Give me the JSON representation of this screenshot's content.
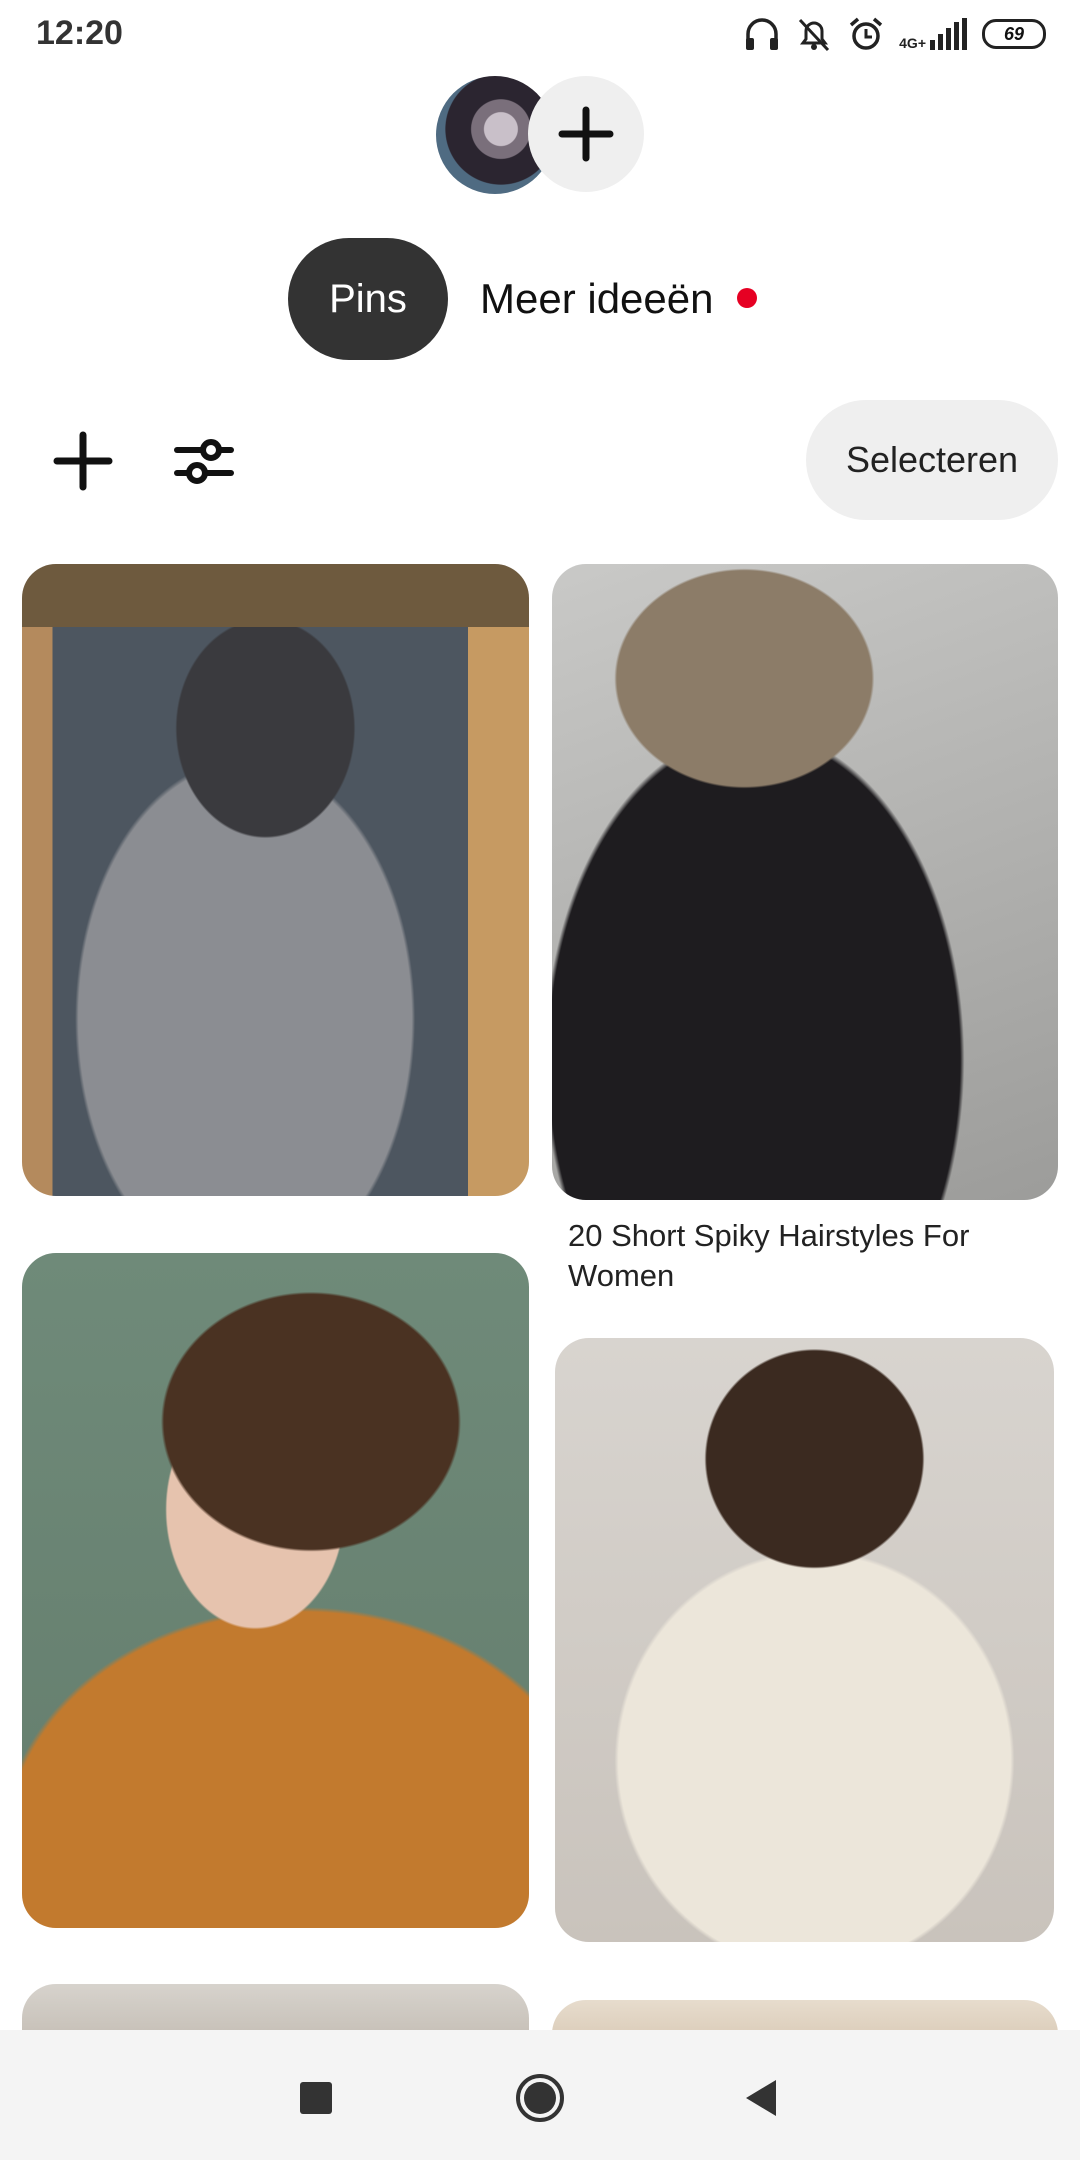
{
  "status_bar": {
    "time": "12:20",
    "network_label": "4G+",
    "battery": "69",
    "icons": [
      "headphones-icon",
      "alarm-muted-icon",
      "alarm-clock-icon",
      "signal-icon",
      "battery-icon"
    ]
  },
  "header": {
    "avatar_icon": "profile-avatar",
    "add_icon": "plus-icon"
  },
  "tabs": [
    {
      "label": "Pins",
      "selected": true
    },
    {
      "label": "Meer ideeën",
      "selected": false,
      "has_notification_dot": true
    }
  ],
  "toolbar": {
    "add_icon": "plus-icon",
    "filter_icon": "filter-sliders-icon",
    "select_label": "Selecteren"
  },
  "pins": [
    {
      "title": ""
    },
    {
      "title": "20 Short Spiky Hairstyles For Women"
    },
    {
      "title": ""
    },
    {
      "title": ""
    }
  ],
  "nav_bar": {
    "icons": [
      "recent-apps-icon",
      "home-icon",
      "back-icon"
    ]
  },
  "colors": {
    "accent_red": "#e60023",
    "tab_selected_bg": "#333333",
    "button_bg": "#efefef"
  }
}
